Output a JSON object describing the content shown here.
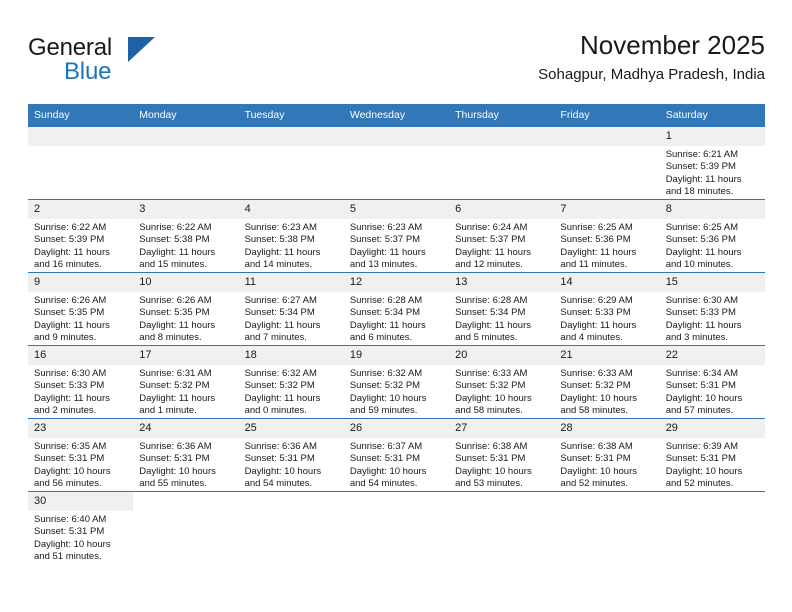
{
  "brand": {
    "name_top": "General",
    "name_bottom": "Blue",
    "accent_color": "#1b75bb",
    "triangle_color": "#1b63a5"
  },
  "header": {
    "title": "November 2025",
    "subtitle": "Sohagpur, Madhya Pradesh, India"
  },
  "theme": {
    "header_row_bg": "#3277b8",
    "daynum_bg": "#f0f0f0",
    "grid_line": "#3277b8"
  },
  "weekday_headers": [
    "Sunday",
    "Monday",
    "Tuesday",
    "Wednesday",
    "Thursday",
    "Friday",
    "Saturday"
  ],
  "weeks": [
    [
      {
        "day": "",
        "sunrise": "",
        "sunset": "",
        "daylight1": "",
        "daylight2": "",
        "blank": true
      },
      {
        "day": "",
        "sunrise": "",
        "sunset": "",
        "daylight1": "",
        "daylight2": "",
        "blank": true
      },
      {
        "day": "",
        "sunrise": "",
        "sunset": "",
        "daylight1": "",
        "daylight2": "",
        "blank": true
      },
      {
        "day": "",
        "sunrise": "",
        "sunset": "",
        "daylight1": "",
        "daylight2": "",
        "blank": true
      },
      {
        "day": "",
        "sunrise": "",
        "sunset": "",
        "daylight1": "",
        "daylight2": "",
        "blank": true
      },
      {
        "day": "",
        "sunrise": "",
        "sunset": "",
        "daylight1": "",
        "daylight2": "",
        "blank": true
      },
      {
        "day": "1",
        "sunrise": "Sunrise: 6:21 AM",
        "sunset": "Sunset: 5:39 PM",
        "daylight1": "Daylight: 11 hours",
        "daylight2": "and 18 minutes.",
        "blank": false
      }
    ],
    [
      {
        "day": "2",
        "sunrise": "Sunrise: 6:22 AM",
        "sunset": "Sunset: 5:39 PM",
        "daylight1": "Daylight: 11 hours",
        "daylight2": "and 16 minutes.",
        "blank": false
      },
      {
        "day": "3",
        "sunrise": "Sunrise: 6:22 AM",
        "sunset": "Sunset: 5:38 PM",
        "daylight1": "Daylight: 11 hours",
        "daylight2": "and 15 minutes.",
        "blank": false
      },
      {
        "day": "4",
        "sunrise": "Sunrise: 6:23 AM",
        "sunset": "Sunset: 5:38 PM",
        "daylight1": "Daylight: 11 hours",
        "daylight2": "and 14 minutes.",
        "blank": false
      },
      {
        "day": "5",
        "sunrise": "Sunrise: 6:23 AM",
        "sunset": "Sunset: 5:37 PM",
        "daylight1": "Daylight: 11 hours",
        "daylight2": "and 13 minutes.",
        "blank": false
      },
      {
        "day": "6",
        "sunrise": "Sunrise: 6:24 AM",
        "sunset": "Sunset: 5:37 PM",
        "daylight1": "Daylight: 11 hours",
        "daylight2": "and 12 minutes.",
        "blank": false
      },
      {
        "day": "7",
        "sunrise": "Sunrise: 6:25 AM",
        "sunset": "Sunset: 5:36 PM",
        "daylight1": "Daylight: 11 hours",
        "daylight2": "and 11 minutes.",
        "blank": false
      },
      {
        "day": "8",
        "sunrise": "Sunrise: 6:25 AM",
        "sunset": "Sunset: 5:36 PM",
        "daylight1": "Daylight: 11 hours",
        "daylight2": "and 10 minutes.",
        "blank": false
      }
    ],
    [
      {
        "day": "9",
        "sunrise": "Sunrise: 6:26 AM",
        "sunset": "Sunset: 5:35 PM",
        "daylight1": "Daylight: 11 hours",
        "daylight2": "and 9 minutes.",
        "blank": false
      },
      {
        "day": "10",
        "sunrise": "Sunrise: 6:26 AM",
        "sunset": "Sunset: 5:35 PM",
        "daylight1": "Daylight: 11 hours",
        "daylight2": "and 8 minutes.",
        "blank": false
      },
      {
        "day": "11",
        "sunrise": "Sunrise: 6:27 AM",
        "sunset": "Sunset: 5:34 PM",
        "daylight1": "Daylight: 11 hours",
        "daylight2": "and 7 minutes.",
        "blank": false
      },
      {
        "day": "12",
        "sunrise": "Sunrise: 6:28 AM",
        "sunset": "Sunset: 5:34 PM",
        "daylight1": "Daylight: 11 hours",
        "daylight2": "and 6 minutes.",
        "blank": false
      },
      {
        "day": "13",
        "sunrise": "Sunrise: 6:28 AM",
        "sunset": "Sunset: 5:34 PM",
        "daylight1": "Daylight: 11 hours",
        "daylight2": "and 5 minutes.",
        "blank": false
      },
      {
        "day": "14",
        "sunrise": "Sunrise: 6:29 AM",
        "sunset": "Sunset: 5:33 PM",
        "daylight1": "Daylight: 11 hours",
        "daylight2": "and 4 minutes.",
        "blank": false
      },
      {
        "day": "15",
        "sunrise": "Sunrise: 6:30 AM",
        "sunset": "Sunset: 5:33 PM",
        "daylight1": "Daylight: 11 hours",
        "daylight2": "and 3 minutes.",
        "blank": false
      }
    ],
    [
      {
        "day": "16",
        "sunrise": "Sunrise: 6:30 AM",
        "sunset": "Sunset: 5:33 PM",
        "daylight1": "Daylight: 11 hours",
        "daylight2": "and 2 minutes.",
        "blank": false
      },
      {
        "day": "17",
        "sunrise": "Sunrise: 6:31 AM",
        "sunset": "Sunset: 5:32 PM",
        "daylight1": "Daylight: 11 hours",
        "daylight2": "and 1 minute.",
        "blank": false
      },
      {
        "day": "18",
        "sunrise": "Sunrise: 6:32 AM",
        "sunset": "Sunset: 5:32 PM",
        "daylight1": "Daylight: 11 hours",
        "daylight2": "and 0 minutes.",
        "blank": false
      },
      {
        "day": "19",
        "sunrise": "Sunrise: 6:32 AM",
        "sunset": "Sunset: 5:32 PM",
        "daylight1": "Daylight: 10 hours",
        "daylight2": "and 59 minutes.",
        "blank": false
      },
      {
        "day": "20",
        "sunrise": "Sunrise: 6:33 AM",
        "sunset": "Sunset: 5:32 PM",
        "daylight1": "Daylight: 10 hours",
        "daylight2": "and 58 minutes.",
        "blank": false
      },
      {
        "day": "21",
        "sunrise": "Sunrise: 6:33 AM",
        "sunset": "Sunset: 5:32 PM",
        "daylight1": "Daylight: 10 hours",
        "daylight2": "and 58 minutes.",
        "blank": false
      },
      {
        "day": "22",
        "sunrise": "Sunrise: 6:34 AM",
        "sunset": "Sunset: 5:31 PM",
        "daylight1": "Daylight: 10 hours",
        "daylight2": "and 57 minutes.",
        "blank": false
      }
    ],
    [
      {
        "day": "23",
        "sunrise": "Sunrise: 6:35 AM",
        "sunset": "Sunset: 5:31 PM",
        "daylight1": "Daylight: 10 hours",
        "daylight2": "and 56 minutes.",
        "blank": false
      },
      {
        "day": "24",
        "sunrise": "Sunrise: 6:36 AM",
        "sunset": "Sunset: 5:31 PM",
        "daylight1": "Daylight: 10 hours",
        "daylight2": "and 55 minutes.",
        "blank": false
      },
      {
        "day": "25",
        "sunrise": "Sunrise: 6:36 AM",
        "sunset": "Sunset: 5:31 PM",
        "daylight1": "Daylight: 10 hours",
        "daylight2": "and 54 minutes.",
        "blank": false
      },
      {
        "day": "26",
        "sunrise": "Sunrise: 6:37 AM",
        "sunset": "Sunset: 5:31 PM",
        "daylight1": "Daylight: 10 hours",
        "daylight2": "and 54 minutes.",
        "blank": false
      },
      {
        "day": "27",
        "sunrise": "Sunrise: 6:38 AM",
        "sunset": "Sunset: 5:31 PM",
        "daylight1": "Daylight: 10 hours",
        "daylight2": "and 53 minutes.",
        "blank": false
      },
      {
        "day": "28",
        "sunrise": "Sunrise: 6:38 AM",
        "sunset": "Sunset: 5:31 PM",
        "daylight1": "Daylight: 10 hours",
        "daylight2": "and 52 minutes.",
        "blank": false
      },
      {
        "day": "29",
        "sunrise": "Sunrise: 6:39 AM",
        "sunset": "Sunset: 5:31 PM",
        "daylight1": "Daylight: 10 hours",
        "daylight2": "and 52 minutes.",
        "blank": false
      }
    ],
    [
      {
        "day": "30",
        "sunrise": "Sunrise: 6:40 AM",
        "sunset": "Sunset: 5:31 PM",
        "daylight1": "Daylight: 10 hours",
        "daylight2": "and 51 minutes.",
        "blank": false
      },
      {
        "day": "",
        "sunrise": "",
        "sunset": "",
        "daylight1": "",
        "daylight2": "",
        "blank": true,
        "void": true
      },
      {
        "day": "",
        "sunrise": "",
        "sunset": "",
        "daylight1": "",
        "daylight2": "",
        "blank": true,
        "void": true
      },
      {
        "day": "",
        "sunrise": "",
        "sunset": "",
        "daylight1": "",
        "daylight2": "",
        "blank": true,
        "void": true
      },
      {
        "day": "",
        "sunrise": "",
        "sunset": "",
        "daylight1": "",
        "daylight2": "",
        "blank": true,
        "void": true
      },
      {
        "day": "",
        "sunrise": "",
        "sunset": "",
        "daylight1": "",
        "daylight2": "",
        "blank": true,
        "void": true
      },
      {
        "day": "",
        "sunrise": "",
        "sunset": "",
        "daylight1": "",
        "daylight2": "",
        "blank": true,
        "void": true
      }
    ]
  ]
}
